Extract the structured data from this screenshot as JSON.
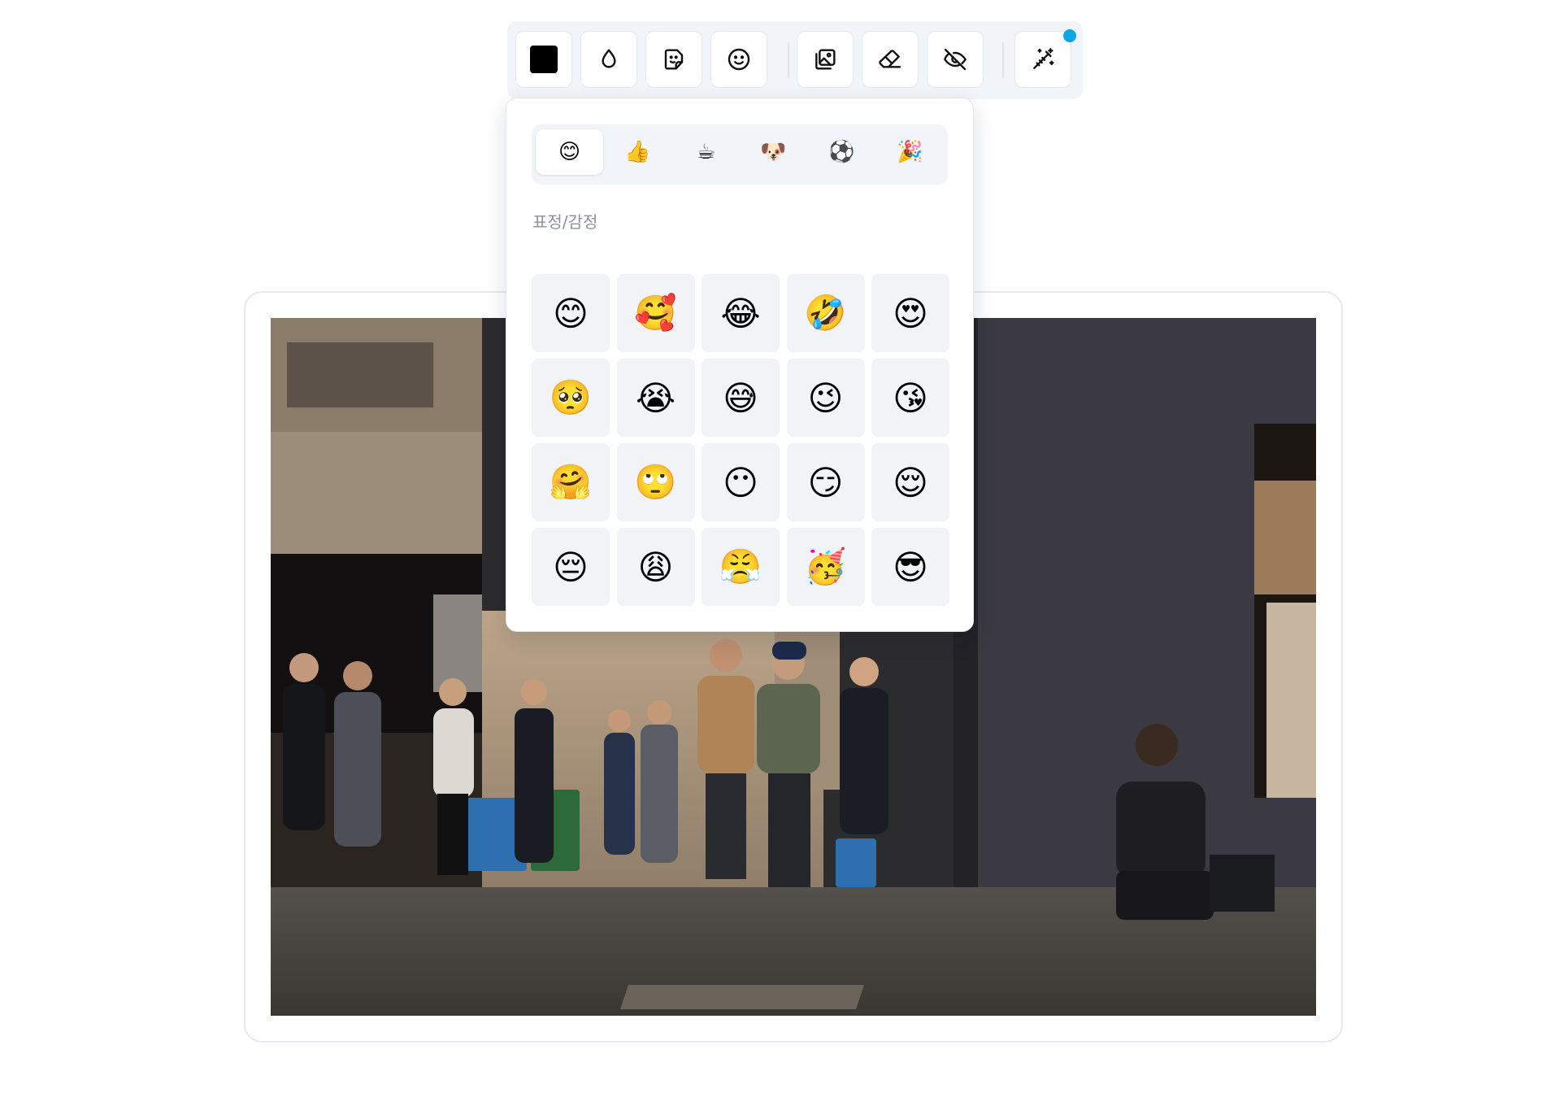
{
  "toolbar": {
    "tools": [
      {
        "id": "color",
        "icon": "color-swatch",
        "color": "#000000"
      },
      {
        "id": "opacity",
        "icon": "droplet-icon"
      },
      {
        "id": "sticker",
        "icon": "sticker-icon"
      },
      {
        "id": "emoji",
        "icon": "smile-icon"
      },
      {
        "id": "image-gallery",
        "icon": "image-gallery-icon"
      },
      {
        "id": "eraser",
        "icon": "eraser-icon"
      },
      {
        "id": "hide",
        "icon": "eye-off-icon"
      },
      {
        "id": "magic",
        "icon": "magic-wand-icon"
      }
    ],
    "notification_color": "#0ea5e9"
  },
  "emoji_panel": {
    "category_tabs": [
      {
        "emoji": "😊",
        "icon": "smileys-tab",
        "active": true
      },
      {
        "emoji": "👍",
        "icon": "gestures-tab",
        "active": false
      },
      {
        "emoji": "☕",
        "icon": "food-tab",
        "active": false
      },
      {
        "emoji": "🐶",
        "icon": "animals-tab",
        "active": false
      },
      {
        "emoji": "⚽",
        "icon": "sports-tab",
        "active": false
      },
      {
        "emoji": "🎉",
        "icon": "celebration-tab",
        "active": false
      }
    ],
    "category_label": "표정/감정",
    "emojis": [
      {
        "glyph": "😊"
      },
      {
        "glyph": "🥰"
      },
      {
        "glyph": "😂"
      },
      {
        "glyph": "🤣"
      },
      {
        "glyph": "😍"
      },
      {
        "glyph": "🥺"
      },
      {
        "glyph": "😭"
      },
      {
        "glyph": "😅"
      },
      {
        "glyph": "😉"
      },
      {
        "glyph": "😘"
      },
      {
        "glyph": "🤗"
      },
      {
        "glyph": "🙄"
      },
      {
        "glyph": "😶"
      },
      {
        "glyph": "😏"
      },
      {
        "glyph": "😌"
      },
      {
        "glyph": "😔"
      },
      {
        "glyph": "😩"
      },
      {
        "glyph": "😤"
      },
      {
        "glyph": "🥳"
      },
      {
        "glyph": "😎"
      }
    ]
  },
  "canvas": {
    "image_alt_icon": "street-photo"
  }
}
